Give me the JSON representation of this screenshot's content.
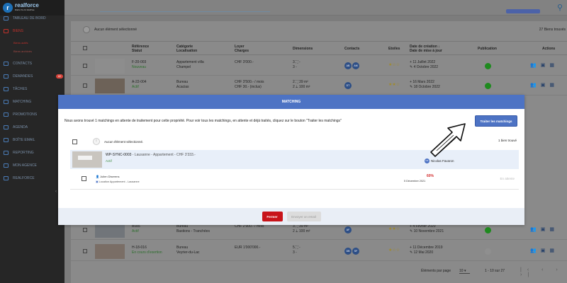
{
  "brand": {
    "logo_letter": "(r",
    "name": "realforce",
    "tagline": "BIEN PLUS SIMPLE"
  },
  "sidebar": {
    "items": [
      {
        "label": "TABLEAU DE BORD"
      },
      {
        "label": "BIENS"
      },
      {
        "label": "CONTACTS"
      },
      {
        "label": "DEMANDES",
        "badge": "62"
      },
      {
        "label": "TÂCHES"
      },
      {
        "label": "MATCHING"
      },
      {
        "label": "PROMOTIONS"
      },
      {
        "label": "AGENDA"
      },
      {
        "label": "BOÎTE EMAIL"
      },
      {
        "label": "REPORTING"
      },
      {
        "label": "MON AGENCE"
      },
      {
        "label": "REALFORCE"
      }
    ],
    "sub_items": [
      "Biens actifs",
      "Biens archivés"
    ]
  },
  "list": {
    "selection_text": "Aucun élément sélectionné",
    "count_text": "27 Biens trouvés",
    "headers": {
      "ref": "Référence",
      "ref2": "Statut",
      "cat": "Catégorie",
      "cat2": "Localisation",
      "rent": "Loyer",
      "rent2": "Charges",
      "dim": "Dimensions",
      "contacts": "Contacts",
      "stars": "Etoiles",
      "date": "Date de création ↓",
      "date2": "Date de mise à jour",
      "pub": "Publication",
      "actions": "Actions"
    },
    "rows": [
      {
        "ref": "F-20-003",
        "status": "Nouveau",
        "cat": "Appartement villa",
        "loc": "Champel",
        "rent": "CHF 3'000.-",
        "rent2": "",
        "dim1": "3  ⛶ -",
        "dim2": "3  -",
        "c1": "AB",
        "c2": "AM",
        "created": "11 Juillet 2022",
        "updated": "4 Octobre 2022"
      },
      {
        "ref": "A-22-004",
        "status": "Actif",
        "cat": "Bureau",
        "loc": "Acacias",
        "rent": "CHF 3'500.- / mois",
        "rent2": "CHF 30.- (inclus)",
        "dim1": "2  ⛶ 39 m²",
        "dim2": "2  ⟂ 100 m²",
        "c1": "DT",
        "c2": "",
        "created": "16 Mars 2022",
        "updated": "18 Octobre 2022"
      },
      {
        "ref": "B085",
        "status": "Actif",
        "cat": "Bureau",
        "loc": "Bastions - Tranchées",
        "rent": "CHF 2'900.- / mois",
        "rent2": "",
        "dim1": "3  ⛶ 39 m²",
        "dim2": "2  ⟂ 100 m²",
        "c1": "AF",
        "c2": "",
        "created": "4 Février 2020",
        "updated": "10 Novembre 2021"
      },
      {
        "ref": "H-18-016",
        "status": "En cours d'exertion",
        "cat": "Bureau",
        "loc": "Veyrier-du-Lac",
        "rent": "EUR 1'000'000.-",
        "rent2": "",
        "dim1": "5  ⛶ -",
        "dim2": "3  -",
        "c1": "DB",
        "c2": "SF",
        "created": "11 Décembre 2019",
        "updated": "12 Mai 2020"
      }
    ],
    "footer": {
      "per_page_label": "Éléments par page",
      "per_page": "10",
      "range": "1 - 10 sur 27"
    }
  },
  "modal": {
    "title": "MATCHING",
    "info": "Nous avons trouvé 1 matchings en attente de traitement pour cette propriété. Pour voir tous les matchings, en attente et déjà traités, cliquez sur le bouton \"Traiter les matchings\"",
    "process_button": "Traiter les matchings",
    "selection_text": "Aucun élément sélectionné.",
    "found_text": "1 bien trouvé",
    "property": {
      "ref": "WP-SYNC-0003",
      "details": " - Lausanne - Appartement - CHF 3'333.-",
      "status": "Actif",
      "agent_initials": "NF",
      "agent": "Nicolas Favaron"
    },
    "match": {
      "name": "Julien Diserens",
      "location": "Location Appartement - Lausanne",
      "percent": "60%",
      "date": "5 Décembre 2021",
      "status": "En attente"
    },
    "close_button": "Fermer",
    "email_button": "Envoyer un email"
  },
  "colors": {
    "accent": "#4d73c4",
    "danger": "#c8141a",
    "sidebar": "#262626"
  }
}
